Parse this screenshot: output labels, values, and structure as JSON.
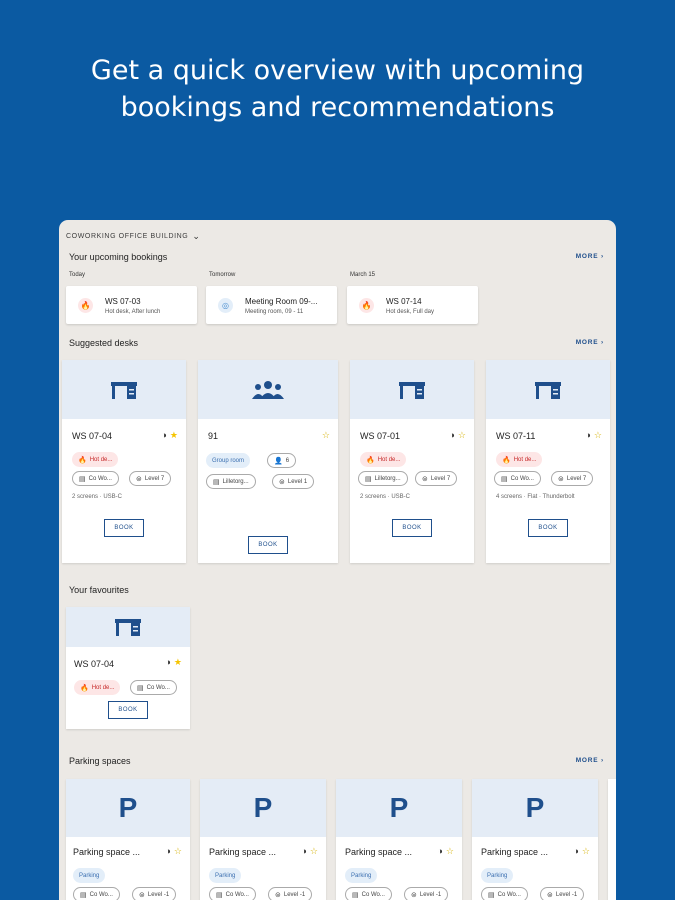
{
  "headline": {
    "line1": "Get a quick overview with upcoming",
    "line2": "bookings and recommendations"
  },
  "building": "COWORKING OFFICE BUILDING",
  "more_label": "MORE",
  "upcoming": {
    "title": "Your upcoming bookings",
    "bookings": [
      {
        "day": "Today",
        "name": "WS 07-03",
        "detail": "Hot desk, After lunch",
        "icon": "flame-icon"
      },
      {
        "day": "Tomorrow",
        "name": "Meeting Room 09-...",
        "detail": "Meeting room, 09 - 11",
        "icon": "globe-icon"
      },
      {
        "day": "March 15",
        "name": "WS 07-14",
        "detail": "Hot desk, Full day",
        "icon": "flame-icon"
      }
    ]
  },
  "suggested": {
    "title": "Suggested desks",
    "cards": [
      {
        "name": "WS 07-04",
        "tag": "Hot de...",
        "loc": "Co Wo...",
        "level": "Level 7",
        "desc": "2 screens · USB-C",
        "book": "BOOK"
      },
      {
        "name": "91",
        "tag": "Group room",
        "cap": "6",
        "loc": "Lilletorg...",
        "level": "Level 1",
        "book": "BOOK"
      },
      {
        "name": "WS 07-01",
        "tag": "Hot de...",
        "loc": "Lilletorg...",
        "level": "Level 7",
        "desc": "2 screens · USB-C",
        "book": "BOOK"
      },
      {
        "name": "WS 07-11",
        "tag": "Hot de...",
        "loc": "Co Wo...",
        "level": "Level 7",
        "desc": "4 screens · Flat · Thunderbolt",
        "book": "BOOK"
      }
    ]
  },
  "favourites": {
    "title": "Your favourites",
    "cards": [
      {
        "name": "WS 07-04",
        "tag": "Hot de...",
        "loc": "Co Wo...",
        "book": "BOOK"
      }
    ]
  },
  "parking": {
    "title": "Parking spaces",
    "icon_letter": "P",
    "cards": [
      {
        "name": "Parking space ...",
        "tag": "Parking",
        "loc": "Co Wo...",
        "level": "Level -1"
      },
      {
        "name": "Parking space ...",
        "tag": "Parking",
        "loc": "Co Wo...",
        "level": "Level -1"
      },
      {
        "name": "Parking space ...",
        "tag": "Parking",
        "loc": "Co Wo...",
        "level": "Level -1"
      },
      {
        "name": "Parking space ...",
        "tag": "Parking",
        "loc": "Co Wo...",
        "level": "Level -1"
      }
    ]
  },
  "colors": {
    "background": "#0b5aa2",
    "accent": "#1f4f8c",
    "panel": "#ece9e5",
    "hot_desk": "#c62828",
    "star": "#f5c400"
  }
}
